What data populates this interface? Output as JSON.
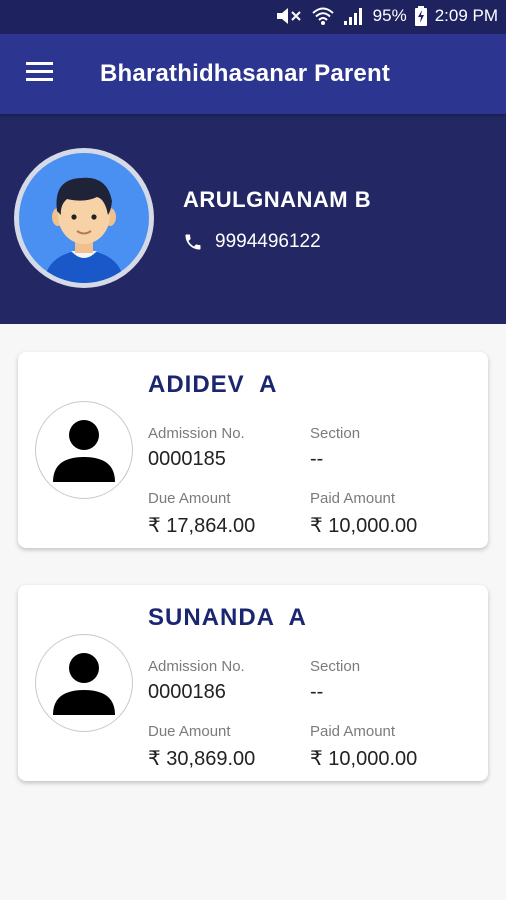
{
  "status": {
    "battery": "95%",
    "time": "2:09 PM"
  },
  "appbar": {
    "title": "Bharathidhasanar Parent"
  },
  "parent": {
    "name": "ARULGNANAM B",
    "phone": "9994496122"
  },
  "labels": {
    "admission": "Admission No.",
    "section": "Section",
    "due": "Due Amount",
    "paid": "Paid Amount"
  },
  "students": [
    {
      "name": "ADIDEV  A",
      "admission_no": "0000185",
      "section": "--",
      "due_amount": "₹ 17,864.00",
      "paid_amount": "₹ 10,000.00"
    },
    {
      "name": "SUNANDA  A",
      "admission_no": "0000186",
      "section": "--",
      "due_amount": "₹ 30,869.00",
      "paid_amount": "₹ 10,000.00"
    }
  ]
}
